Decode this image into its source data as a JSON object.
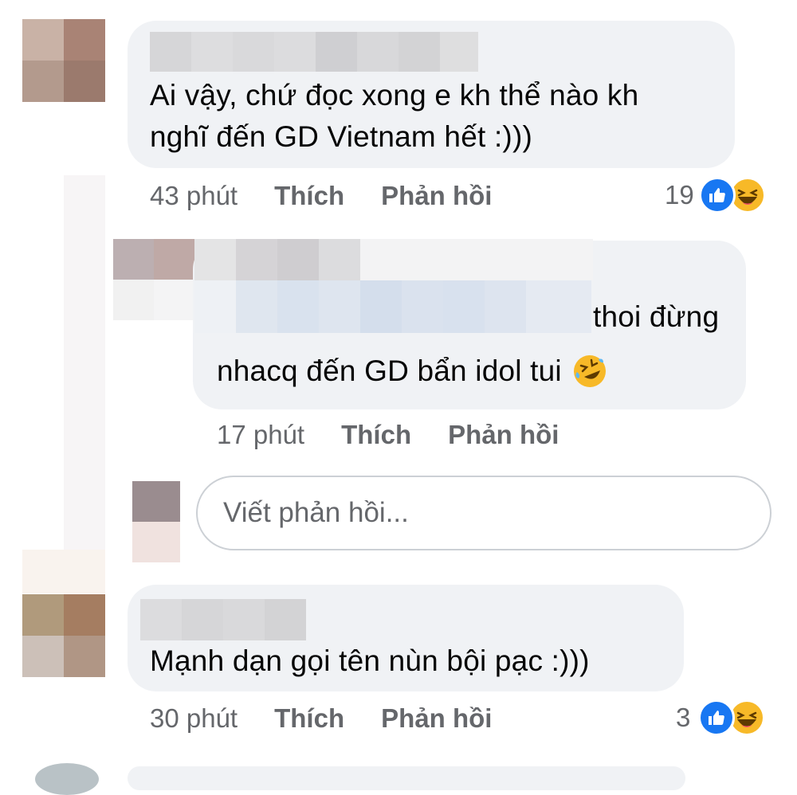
{
  "comments": [
    {
      "text_line1": "Ai vậy, chứ đọc xong e kh thể nào kh",
      "text_line2": "nghĩ đến GD Vietnam hết :)))",
      "time": "43 phút",
      "like_label": "Thích",
      "reply_label": "Phản hồi",
      "reaction_count": "19",
      "reaction_icons": [
        "like-icon",
        "haha-icon"
      ]
    },
    {
      "text_line1_suffix": "thoi đừng",
      "text_line2": "nhacq đến GD bẩn idol tui",
      "text_emoji": "rolling-on-floor-laughing-emoji",
      "time": "17 phút",
      "like_label": "Thích",
      "reply_label": "Phản hồi"
    },
    {
      "text_line1": "Mạnh dạn gọi tên nùn bội pạc :)))",
      "time": "30 phút",
      "like_label": "Thích",
      "reply_label": "Phản hồi",
      "reaction_count": "3",
      "reaction_icons": [
        "like-icon",
        "haha-icon"
      ]
    }
  ],
  "reply_box": {
    "placeholder": "Viết phản hồi..."
  },
  "colors": {
    "bubble_bg": "#f0f2f5",
    "meta_text": "#65676b",
    "like_blue": "#1877f2",
    "haha_yellow": "#f7b928"
  }
}
